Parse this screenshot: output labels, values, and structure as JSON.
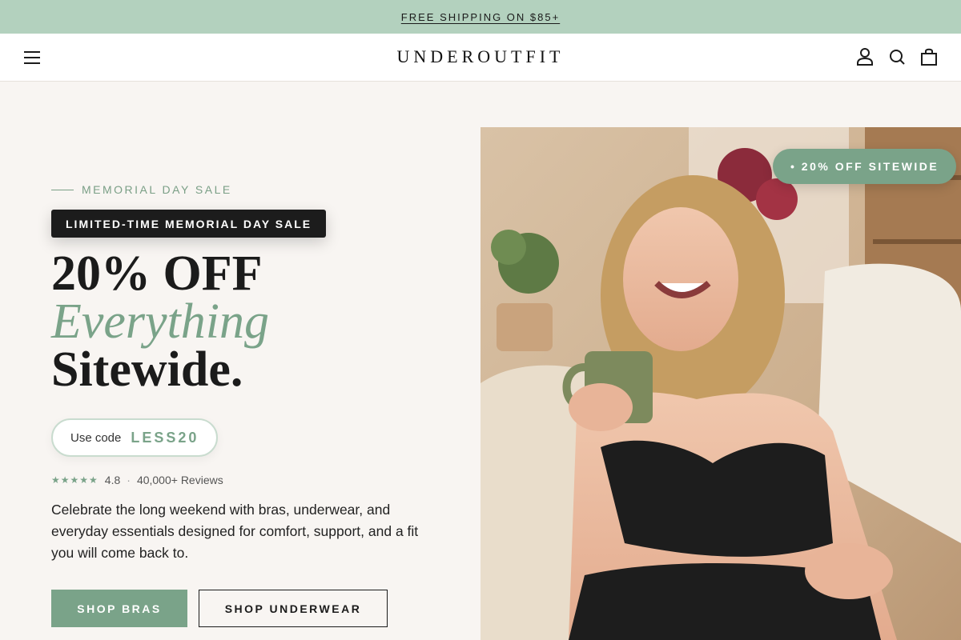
{
  "announcement": {
    "text": "FREE SHIPPING ON $85+"
  },
  "header": {
    "logo": "UNDEROUTFIT",
    "icons": [
      "menu-icon",
      "account-icon",
      "search-icon",
      "bag-icon"
    ]
  },
  "hero": {
    "eyebrow": "MEMORIAL DAY SALE",
    "badge": "LIMITED-TIME MEMORIAL DAY SALE",
    "headline": {
      "line1": "20% OFF",
      "line2": "Everything",
      "line3": "Sitewide."
    },
    "code": {
      "label": "Use code",
      "value": "LESS20"
    },
    "rating": {
      "stars": "★★★★★",
      "score": "4.8",
      "separator": "·",
      "reviews": "40,000+ Reviews"
    },
    "description": "Celebrate the long weekend with bras, underwear, and everyday essentials designed for comfort, support, and a fit you will come back to.",
    "buttons": {
      "primary": "SHOP BRAS",
      "secondary": "SHOP UNDERWEAR"
    },
    "image_tag": "• 20% OFF SITEWIDE"
  },
  "colors": {
    "accent": "#7aa389",
    "announcement_bg": "#b3d1be",
    "page_bg": "#f8f5f2",
    "dark": "#1c1c1c"
  }
}
